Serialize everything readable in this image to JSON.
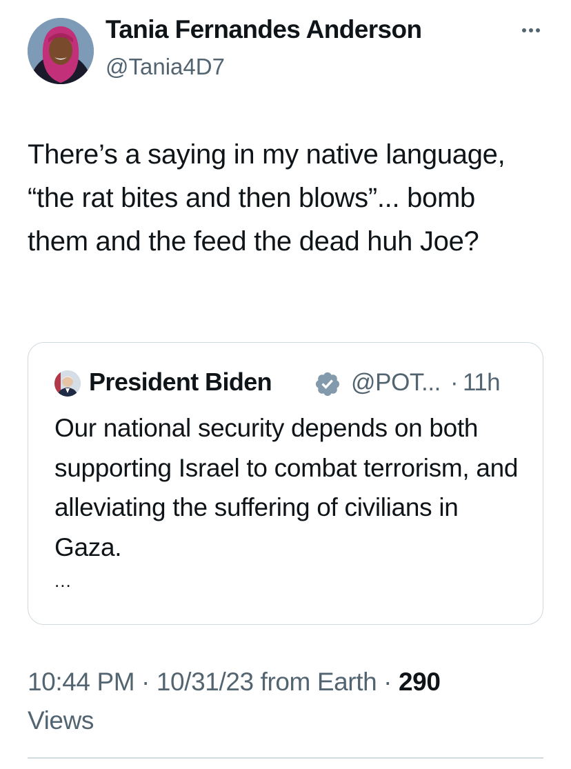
{
  "author": {
    "display_name": "Tania Fernandes Anderson",
    "handle": "@Tania4D7",
    "avatar_icon": "profile-photo-avatar",
    "more_icon": "more-horizontal-icon"
  },
  "tweet": {
    "text": "There’s a saying in my native language, “the rat bites and then blows”... bomb them and the feed the dead huh Joe?"
  },
  "quote": {
    "display_name": "President Biden",
    "verified_icon": "verified-badge-icon",
    "verified_color": "#829aab",
    "handle": "@POT...",
    "separator": "·",
    "time": "11h",
    "text": "Our national security depends on both supporting Israel to combat terrorism, and alleviating the suffering of civilians in Gaza.",
    "truncation": "..."
  },
  "meta": {
    "time": "10:44 PM",
    "sep1": " · ",
    "date": "10/31/23",
    "source": " from Earth",
    "sep2": " · ",
    "views_count": "290",
    "views_label": "Views"
  },
  "colors": {
    "text_primary": "#0f1419",
    "text_secondary": "#536471",
    "border": "#cfd9de"
  }
}
